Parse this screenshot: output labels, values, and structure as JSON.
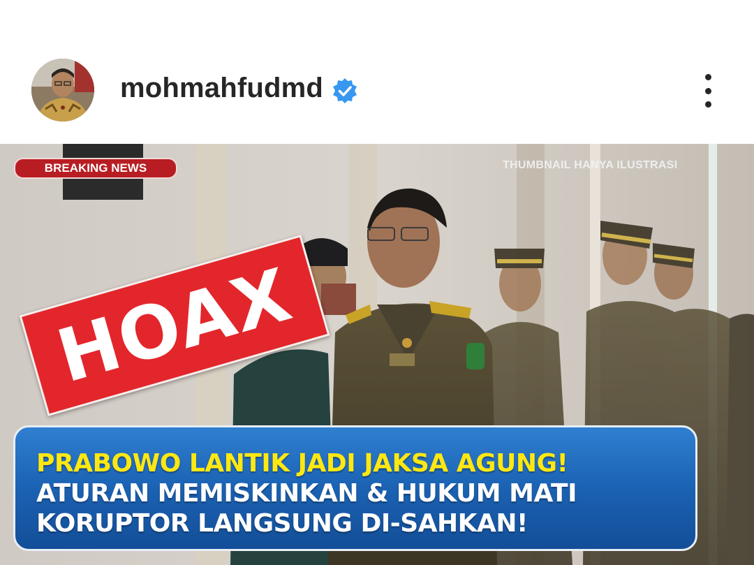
{
  "post_header": {
    "username": "mohmahfudmd",
    "verified": true,
    "avatar_icon": "profile-photo",
    "more_icon": "vertical-ellipsis-icon"
  },
  "post_image": {
    "badge": "BREAKING NEWS",
    "corner_note": "THUMBNAIL HANYA ILUSTRASI",
    "stamp": "HOAX",
    "headline": {
      "line1": "PRABOWO LANTIK JADI JAKSA AGUNG!",
      "line2": "ATURAN MEMISKINKAN & HUKUM MATI",
      "line3": "KORUPTOR LANGSUNG DI-SAHKAN!"
    }
  },
  "colors": {
    "verified_blue": "#3897f0",
    "badge_red": "#b81d23",
    "stamp_red": "#e3262b",
    "headline_yellow": "#ffe812",
    "banner_blue": "#1b62b3"
  }
}
